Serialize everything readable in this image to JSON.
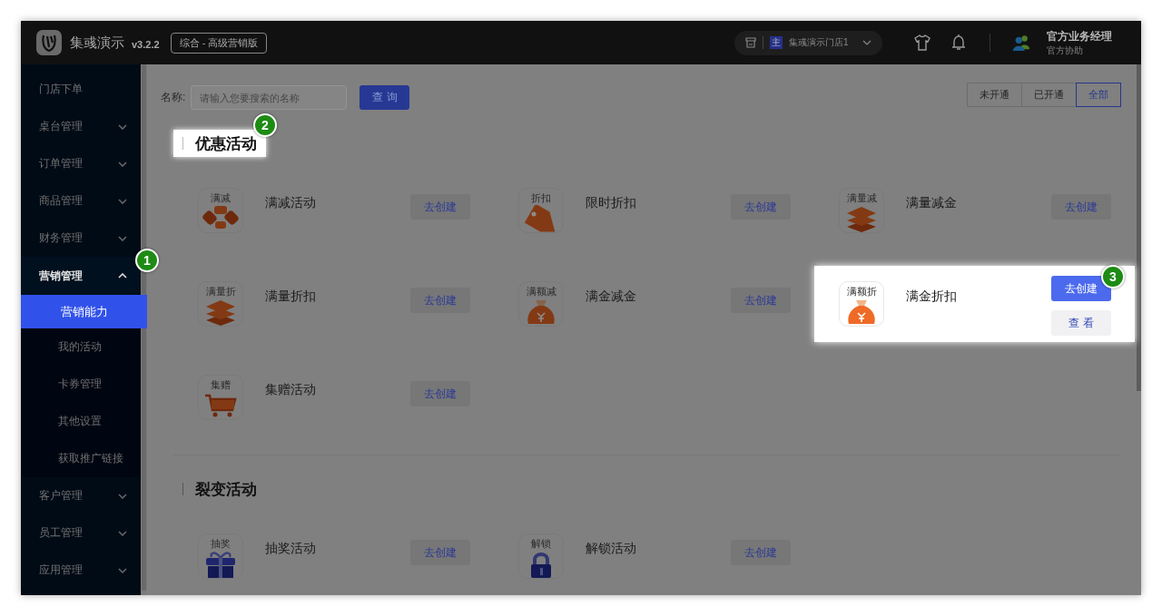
{
  "header": {
    "brand": "集彧演示",
    "version": "v3.2.2",
    "edition": "综合 - 高级营销版",
    "store": {
      "badge": "主",
      "name": "集彧演示门店1"
    },
    "user": {
      "name": "官方业务经理",
      "role": "官方协助"
    }
  },
  "sidebar": {
    "items": [
      {
        "label": "门店下单",
        "kind": "link"
      },
      {
        "label": "桌台管理",
        "kind": "group",
        "expanded": false
      },
      {
        "label": "订单管理",
        "kind": "group",
        "expanded": false
      },
      {
        "label": "商品管理",
        "kind": "group",
        "expanded": false
      },
      {
        "label": "财务管理",
        "kind": "group",
        "expanded": false
      },
      {
        "label": "营销管理",
        "kind": "group",
        "expanded": true,
        "step": "1",
        "children": [
          {
            "label": "营销能力",
            "selected": true
          },
          {
            "label": "我的活动",
            "selected": false
          },
          {
            "label": "卡券管理",
            "selected": false
          },
          {
            "label": "其他设置",
            "selected": false
          },
          {
            "label": "获取推广链接",
            "selected": false
          }
        ]
      },
      {
        "label": "客户管理",
        "kind": "group",
        "expanded": false
      },
      {
        "label": "员工管理",
        "kind": "group",
        "expanded": false
      },
      {
        "label": "应用管理",
        "kind": "group",
        "expanded": false
      }
    ]
  },
  "filter": {
    "label": "名称:",
    "placeholder": "请输入您要搜索的名称",
    "button": "查 询",
    "segments": [
      {
        "label": "未开通",
        "selected": false
      },
      {
        "label": "已开通",
        "selected": false
      },
      {
        "label": "全部",
        "selected": true
      }
    ]
  },
  "sections": [
    {
      "title": "优惠活动",
      "highlighted": true,
      "step": "2",
      "items": [
        {
          "icon_label": "满减",
          "kind": "coins",
          "title": "满减活动",
          "create": "去创建",
          "highlighted": false
        },
        {
          "icon_label": "折扣",
          "kind": "tag",
          "title": "限时折扣",
          "create": "去创建",
          "highlighted": false
        },
        {
          "icon_label": "满量减",
          "kind": "stack",
          "title": "满量减金",
          "create": "去创建",
          "highlighted": false
        },
        {
          "icon_label": "满量折",
          "kind": "stack",
          "title": "满量折扣",
          "create": "去创建",
          "highlighted": false
        },
        {
          "icon_label": "满额减",
          "kind": "bag",
          "title": "满金减金",
          "create": "去创建",
          "highlighted": false
        },
        {
          "icon_label": "满额折",
          "kind": "bag",
          "title": "满金折扣",
          "create": "去创建",
          "view": "查 看",
          "highlighted": true,
          "step": "3"
        },
        {
          "icon_label": "集赠",
          "kind": "cart",
          "title": "集赠活动",
          "create": "去创建",
          "highlighted": false
        }
      ]
    },
    {
      "title": "裂变活动",
      "highlighted": false,
      "items": [
        {
          "icon_label": "抽奖",
          "kind": "gift",
          "title": "抽奖活动",
          "create": "去创建",
          "highlighted": false
        },
        {
          "icon_label": "解锁",
          "kind": "lock",
          "title": "解锁活动",
          "create": "去创建",
          "highlighted": false
        }
      ]
    }
  ]
}
